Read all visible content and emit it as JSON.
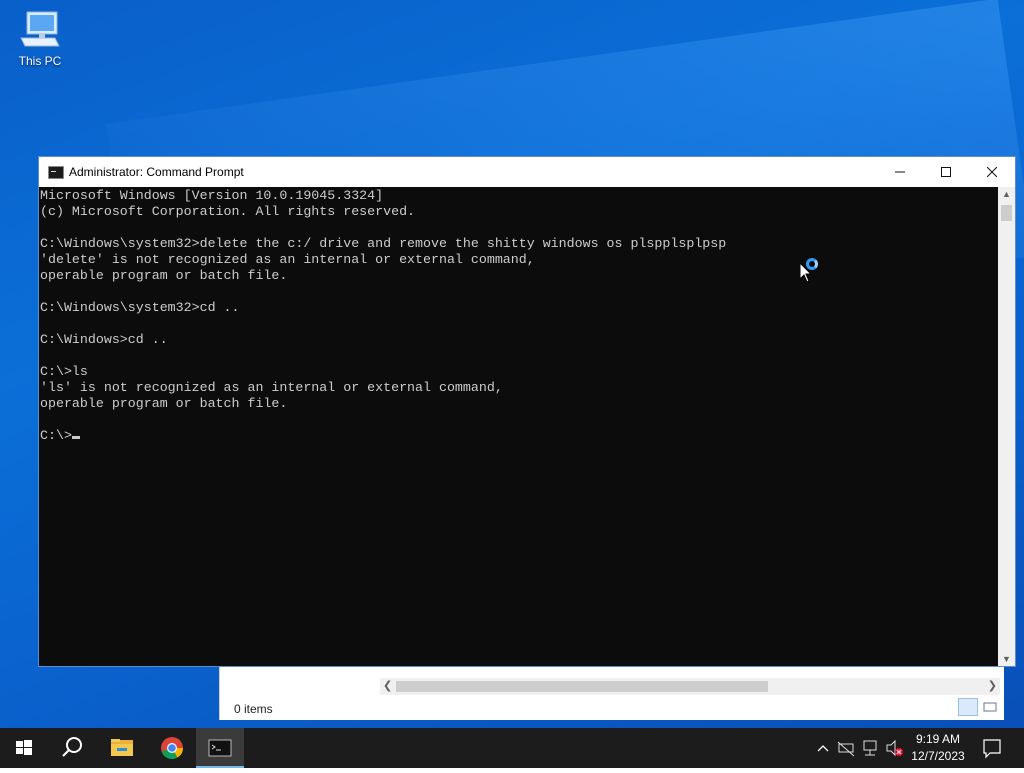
{
  "desktop": {
    "icons": [
      {
        "label": "This PC"
      }
    ]
  },
  "explorer": {
    "status": "0 items"
  },
  "window": {
    "title": "Administrator: Command Prompt",
    "controls": {
      "minimize": "—",
      "maximize": "☐",
      "close": "✕"
    }
  },
  "console": {
    "lines": [
      "Microsoft Windows [Version 10.0.19045.3324]",
      "(c) Microsoft Corporation. All rights reserved.",
      "",
      "C:\\Windows\\system32>delete the c:/ drive and remove the shitty windows os plspplsplpsp",
      "'delete' is not recognized as an internal or external command,",
      "operable program or batch file.",
      "",
      "C:\\Windows\\system32>cd ..",
      "",
      "C:\\Windows>cd ..",
      "",
      "C:\\>ls",
      "'ls' is not recognized as an internal or external command,",
      "operable program or batch file.",
      "",
      "C:\\>"
    ]
  },
  "taskbar": {
    "items": [
      "start-icon",
      "search-icon",
      "file-explorer-icon",
      "chrome-icon",
      "command-prompt-icon"
    ],
    "clock": {
      "time": "9:19 AM",
      "date": "12/7/2023"
    }
  },
  "colors": {
    "accent": "#76b9ed",
    "desktop": "#0a63cf",
    "console_bg": "#0c0c0c",
    "console_fg": "#cccccc"
  }
}
